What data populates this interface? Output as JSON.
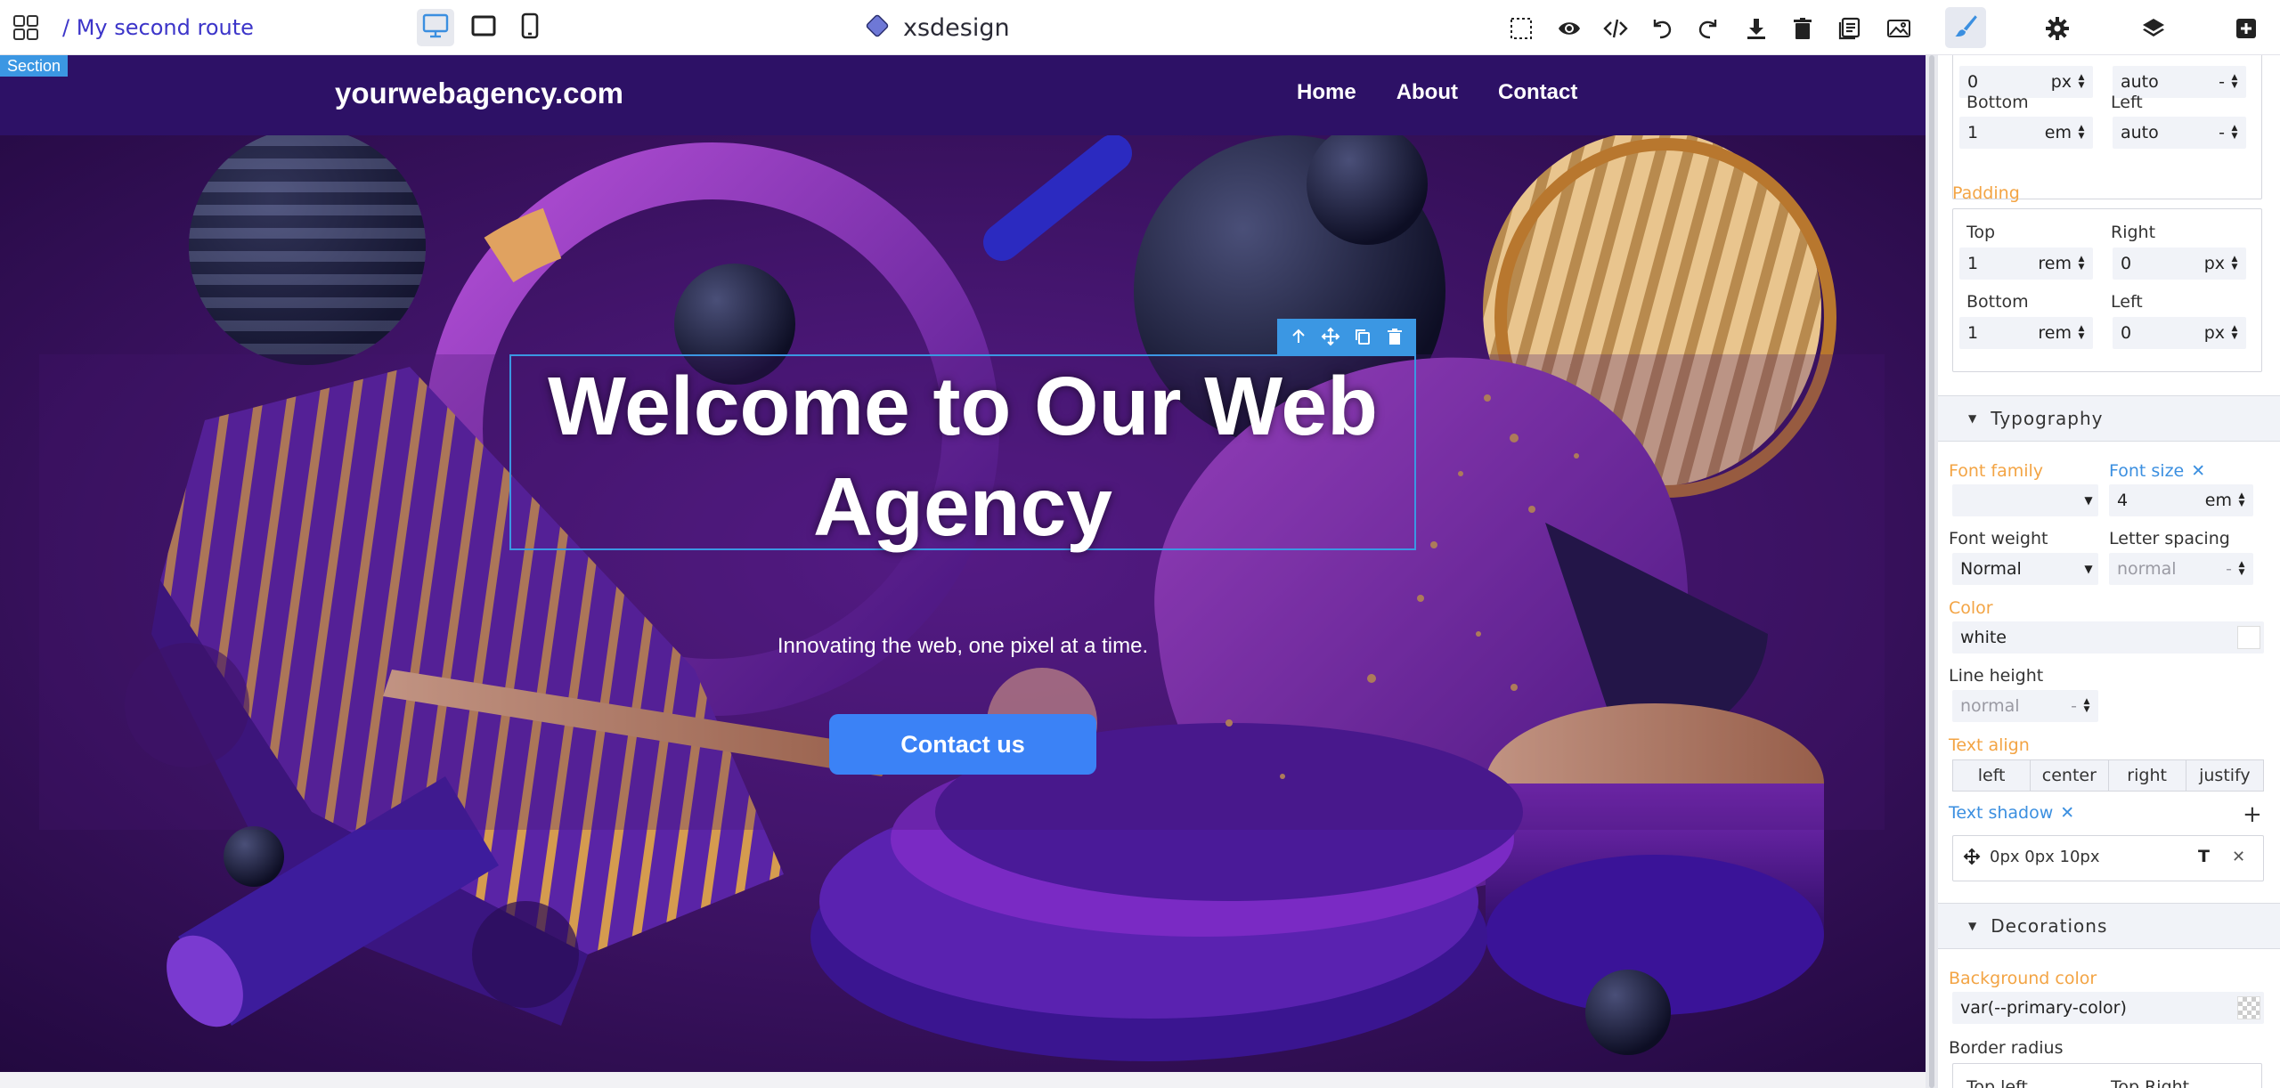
{
  "topbar": {
    "route": "/ My second route",
    "brand": "xsdesign",
    "icons": [
      "grid-icon",
      "desktop-icon",
      "tablet-icon",
      "mobile-icon",
      "select-icon",
      "preview-eye-icon",
      "code-icon",
      "undo-icon",
      "redo-icon",
      "download-icon",
      "trash-icon",
      "pages-icon",
      "image-icon",
      "brush-icon",
      "gear-icon",
      "layers-icon",
      "add-icon"
    ]
  },
  "canvas": {
    "section_tag": "Section",
    "site_logo": "yourwebagency.com",
    "nav": [
      "Home",
      "About",
      "Contact"
    ],
    "heading": "Welcome to Our Web Agency",
    "subtitle": "Innovating the web, one pixel at a time.",
    "cta": "Contact us"
  },
  "panel": {
    "margin": {
      "top_value": "0",
      "top_unit": "px",
      "right_value": "auto",
      "right_unit": "-",
      "bottom_label": "Bottom",
      "bottom_value": "1",
      "bottom_unit": "em",
      "left_label": "Left",
      "left_value": "auto",
      "left_unit": "-"
    },
    "padding": {
      "label": "Padding",
      "top_label": "Top",
      "top_value": "1",
      "top_unit": "rem",
      "right_label": "Right",
      "right_value": "0",
      "right_unit": "px",
      "bottom_label": "Bottom",
      "bottom_value": "1",
      "bottom_unit": "rem",
      "left_label": "Left",
      "left_value": "0",
      "left_unit": "px"
    },
    "typography": {
      "title": "Typography",
      "font_family_label": "Font family",
      "font_size_label": "Font size",
      "font_size_value": "4",
      "font_size_unit": "em",
      "font_weight_label": "Font weight",
      "font_weight_value": "Normal",
      "letter_spacing_label": "Letter spacing",
      "letter_spacing_value": "normal",
      "letter_spacing_unit": "-",
      "color_label": "Color",
      "color_value": "white",
      "line_height_label": "Line height",
      "line_height_value": "normal",
      "line_height_unit": "-",
      "text_align_label": "Text align",
      "align_options": [
        "left",
        "center",
        "right",
        "justify"
      ],
      "text_shadow_label": "Text shadow",
      "text_shadow_value": "0px 0px 10px"
    },
    "decorations": {
      "title": "Decorations",
      "bg_label": "Background color",
      "bg_value": "var(--primary-color)",
      "radius_label": "Border radius",
      "radius_sub_left": "Top left",
      "radius_sub_right": "Top Right"
    }
  },
  "colors": {
    "accent_blue": "#3b97e3",
    "route_purple": "#3c35c9",
    "cta_blue": "#3b82f6",
    "label_orange": "#f3a444",
    "nav_bg": "#2d1166"
  }
}
